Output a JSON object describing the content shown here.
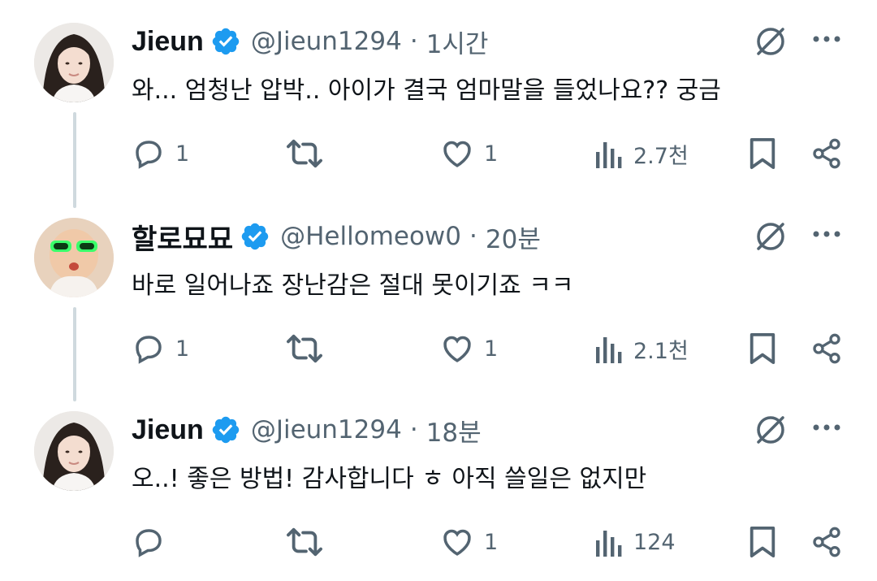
{
  "tweets": [
    {
      "name": "Jieun",
      "handle": "@Jieun1294",
      "dot": "·",
      "time": "1시간",
      "text": "와... 엄청난 압박.. 아이가 결국 엄마말을 들었나요?? 궁금",
      "replies": "1",
      "retweets": "",
      "likes": "1",
      "views": "2.7천"
    },
    {
      "name": "할로묘묘",
      "handle": "@Hellomeow0",
      "dot": "·",
      "time": "20분",
      "text": "바로 일어나죠 장난감은 절대 못이기죠 ㅋㅋ",
      "replies": "1",
      "retweets": "",
      "likes": "1",
      "views": "2.1천"
    },
    {
      "name": "Jieun",
      "handle": "@Jieun1294",
      "dot": "·",
      "time": "18분",
      "text": "오..! 좋은 방법! 감사합니다 ㅎ 아직 쓸일은 없지만",
      "replies": "",
      "retweets": "",
      "likes": "1",
      "views": "124"
    }
  ],
  "icons": {
    "verified": "verified-badge-icon",
    "grok": "grok-icon",
    "more": "more-icon",
    "reply": "reply-icon",
    "retweet": "retweet-icon",
    "like": "like-icon",
    "views": "views-icon",
    "bookmark": "bookmark-icon",
    "share": "share-icon"
  },
  "colors": {
    "verified": "#1d9bf0",
    "text": "#0f1419",
    "secondary": "#536471",
    "thread_line": "#cfd9de"
  }
}
